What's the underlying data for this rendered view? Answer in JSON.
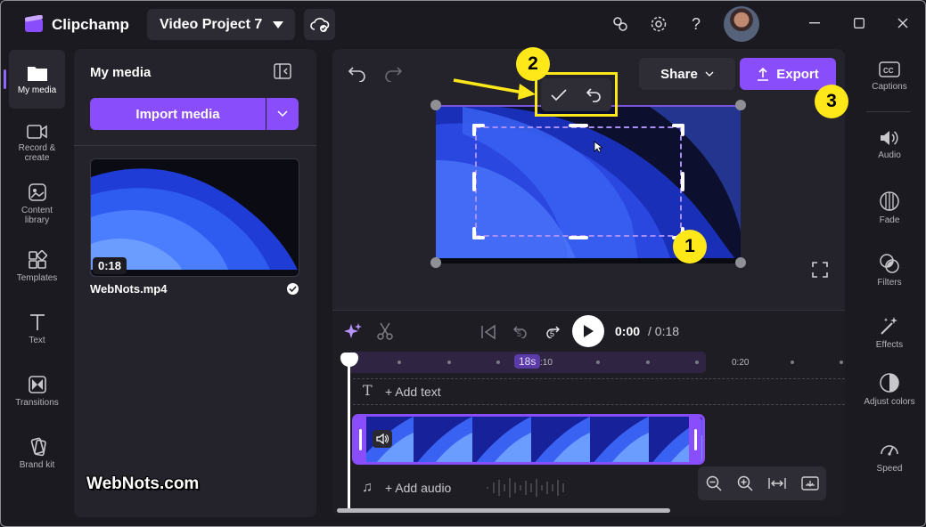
{
  "app": {
    "title": "Clipchamp",
    "brand_color": "#8a4dfb"
  },
  "header": {
    "project_name": "Video Project 7",
    "icons": [
      "cloud-sync-icon",
      "connect-icon",
      "settings-icon",
      "help-icon",
      "user-avatar"
    ]
  },
  "left_nav": {
    "items": [
      {
        "label": "My media",
        "icon": "folder-icon",
        "active": true
      },
      {
        "label": "Record & create",
        "icon": "camera-icon"
      },
      {
        "label": "Content library",
        "icon": "library-icon"
      },
      {
        "label": "Templates",
        "icon": "templates-icon"
      },
      {
        "label": "Text",
        "icon": "text-icon"
      },
      {
        "label": "Transitions",
        "icon": "transitions-icon"
      },
      {
        "label": "Brand kit",
        "icon": "brand-kit-icon"
      }
    ]
  },
  "media_panel": {
    "title": "My media",
    "import_label": "Import media",
    "items": [
      {
        "name": "WebNots.mp4",
        "duration": "0:18"
      }
    ]
  },
  "preview": {
    "share_label": "Share",
    "export_label": "Export",
    "callouts": [
      "1",
      "2",
      "3"
    ],
    "callout_color": "#ffe81a"
  },
  "timeline": {
    "current_time": "0:00",
    "total_time": "/ 0:18",
    "skip_back": "5",
    "skip_forward": "5",
    "clip_badge": "18s",
    "ruler_labels": [
      ":10",
      "0:20"
    ],
    "add_text": "+ Add text",
    "add_audio": "+ Add audio"
  },
  "right_rail": {
    "items": [
      {
        "label": "Captions",
        "icon": "captions-icon"
      },
      {
        "label": "Audio",
        "icon": "speaker-icon"
      },
      {
        "label": "Fade",
        "icon": "fade-icon"
      },
      {
        "label": "Filters",
        "icon": "filters-icon"
      },
      {
        "label": "Effects",
        "icon": "effects-icon"
      },
      {
        "label": "Adjust colors",
        "icon": "adjust-colors-icon"
      },
      {
        "label": "Speed",
        "icon": "speed-icon"
      }
    ]
  },
  "watermark": "WebNots.com"
}
